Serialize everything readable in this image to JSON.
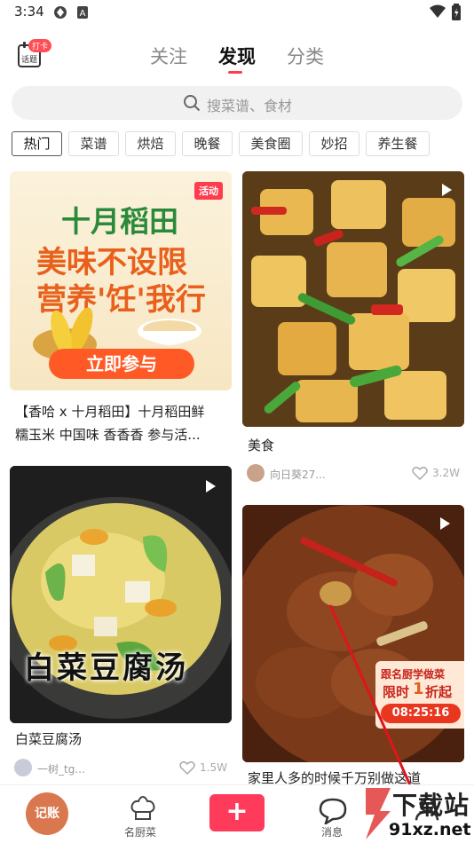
{
  "status": {
    "time": "3:34"
  },
  "header": {
    "badge": "打卡",
    "calendar_label": "话题",
    "tabs": [
      {
        "label": "关注",
        "active": false
      },
      {
        "label": "发现",
        "active": true
      },
      {
        "label": "分类",
        "active": false
      }
    ]
  },
  "search": {
    "placeholder": "搜菜谱、食材"
  },
  "chips": [
    "热门",
    "菜谱",
    "烘焙",
    "晚餐",
    "美食圈",
    "妙招",
    "养生餐"
  ],
  "feed": {
    "card1": {
      "tag": "活动",
      "brand": "十月稻田",
      "slogan1": "美味不设限",
      "slogan2": "营养'饪'我行",
      "cta": "立即参与",
      "title_line1": "【香哈 x 十月稻田】十月稻田鲜",
      "title_line2": "糯玉米 中国味 香香香 参与活..."
    },
    "card2": {
      "title": "美食",
      "author": "向日葵27...",
      "likes": "3.2W"
    },
    "card3": {
      "overlay_text": "白菜豆腐汤",
      "title": "白菜豆腐汤",
      "author": "一树_tg...",
      "likes": "1.5W"
    },
    "card4": {
      "promo_line1": "跟名厨学做菜",
      "promo_line2a": "限时",
      "promo_line2b": "1",
      "promo_line2c": "折起",
      "countdown": "08:25:16",
      "title": "家里人多的时候千万别做这道"
    }
  },
  "nav": {
    "jizhang": "记账",
    "chef_label": "名厨菜",
    "plus": "+",
    "message_label": "消息"
  },
  "watermark": {
    "top": "下载站",
    "bottom": "91xz.net"
  },
  "colors": {
    "accent": "#ff3b4e",
    "plus": "#ff3b5c",
    "jizhang": "#d9784f"
  }
}
